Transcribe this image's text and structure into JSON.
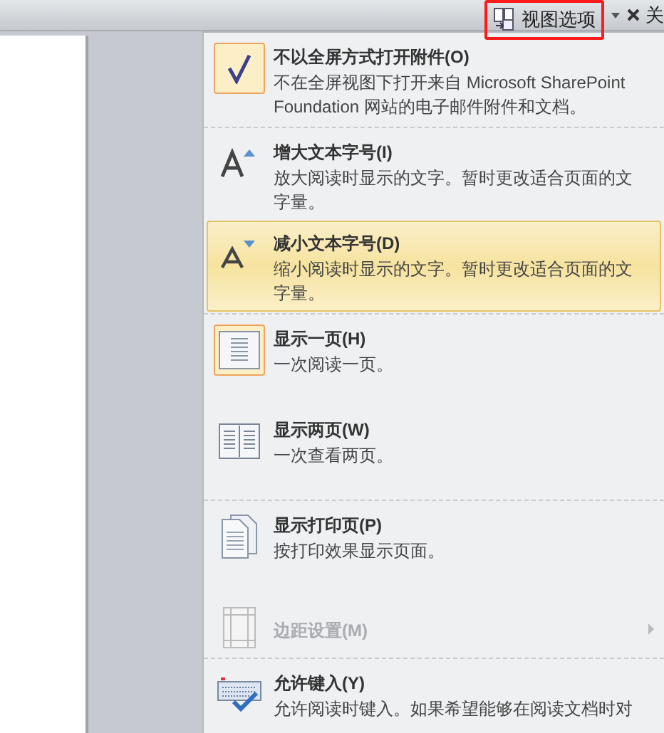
{
  "toolbar": {
    "view_options": {
      "label": "视图选项",
      "highlighted": true
    },
    "close": {
      "label": "关"
    }
  },
  "menu": {
    "groups": [
      {
        "items": [
          {
            "kind": "check",
            "title": "不以全屏方式打开附件(O)",
            "description": "不在全屏视图下打开来自 Microsoft SharePoint Foundation 网站的电子邮件附件和文档。",
            "checked": true,
            "selected": false,
            "disabled": false,
            "submenu": false
          }
        ]
      },
      {
        "items": [
          {
            "kind": "font-up",
            "title": "增大文本字号(I)",
            "description": "放大阅读时显示的文字。暂时更改适合页面的文字量。",
            "checked": false,
            "selected": false,
            "disabled": false,
            "submenu": false
          },
          {
            "kind": "font-down",
            "title": "减小文本字号(D)",
            "description": "缩小阅读时显示的文字。暂时更改适合页面的文字量。",
            "checked": false,
            "selected": true,
            "disabled": false,
            "submenu": false
          }
        ]
      },
      {
        "items": [
          {
            "kind": "one-page",
            "title": "显示一页(H)",
            "description": "一次阅读一页。",
            "checked": true,
            "selected": false,
            "disabled": false,
            "submenu": false
          },
          {
            "kind": "two-pages",
            "title": "显示两页(W)",
            "description": "一次查看两页。",
            "checked": false,
            "selected": false,
            "disabled": false,
            "submenu": false
          }
        ]
      },
      {
        "items": [
          {
            "kind": "print-page",
            "title": "显示打印页(P)",
            "description": "按打印效果显示页面。",
            "checked": false,
            "selected": false,
            "disabled": false,
            "submenu": false
          },
          {
            "kind": "margins",
            "title": "边距设置(M)",
            "checked": false,
            "selected": false,
            "disabled": true,
            "submenu": true
          }
        ]
      },
      {
        "items": [
          {
            "kind": "keyboard",
            "title": "允许键入(Y)",
            "description": "允许阅读时键入。如果希望能够在阅读文档时对",
            "checked": false,
            "selected": false,
            "disabled": false,
            "submenu": false
          }
        ]
      }
    ]
  }
}
